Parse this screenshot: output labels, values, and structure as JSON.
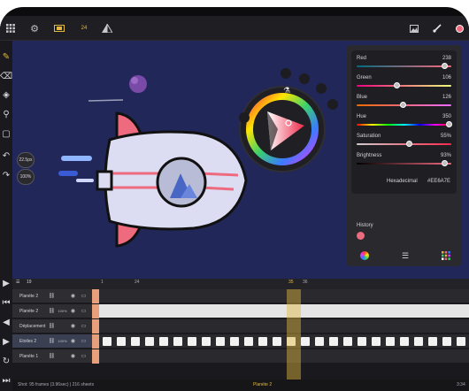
{
  "toolbar": {
    "frame_number": "24",
    "icons": [
      "grid-icon",
      "gear-icon",
      "film-icon",
      "shape-icon",
      "image-icon",
      "brush-icon"
    ],
    "accent_color": "#ee6a7e"
  },
  "canvas": {
    "background": "#22275a",
    "zoom_label": "100%",
    "size_label": "22.5px"
  },
  "color_picker": {
    "sliders": [
      {
        "name": "Red",
        "value": "238",
        "level": 0.93,
        "gradient": "linear-gradient(90deg,#006a7e,#ff6a7e)"
      },
      {
        "name": "Green",
        "value": "106",
        "level": 0.42,
        "gradient": "linear-gradient(90deg,#ee007e,#eeff7e)"
      },
      {
        "name": "Blue",
        "value": "126",
        "level": 0.49,
        "gradient": "linear-gradient(90deg,#ee6a00,#ee6aff)"
      },
      {
        "name": "Hue",
        "value": "350",
        "level": 0.97,
        "gradient": "linear-gradient(90deg,#ff0000,#ffff00,#00ff00,#00ffff,#0000ff,#ff00ff,#ff0000)"
      },
      {
        "name": "Saturation",
        "value": "55%",
        "level": 0.55,
        "gradient": "linear-gradient(90deg,#cccccc,#ff2a4a)"
      },
      {
        "name": "Brightness",
        "value": "93%",
        "level": 0.93,
        "gradient": "linear-gradient(90deg,#000000,#ee6a7e)"
      }
    ],
    "hex_label": "Hexadecimal",
    "hex_value": "#EE6A7E",
    "history_label": "History",
    "history_color": "#ee6a7e"
  },
  "timeline": {
    "layer_count": "19",
    "ruler_ticks": [
      "1",
      "24",
      "35",
      "36"
    ],
    "layers": [
      {
        "name": "Planète 2",
        "opacity": "",
        "selected": false
      },
      {
        "name": "Planète 2",
        "opacity": "100%",
        "selected": false
      },
      {
        "name": "Déplacement",
        "opacity": "",
        "selected": false
      },
      {
        "name": "Etoiles 2",
        "opacity": "100%",
        "selected": true
      },
      {
        "name": "Planète 1",
        "opacity": "",
        "selected": false
      }
    ],
    "footer_left": "Shot: 95 frames (3.96sec) | 216 sheets",
    "footer_playback": "Planète 2",
    "footer_right": "3:34"
  }
}
